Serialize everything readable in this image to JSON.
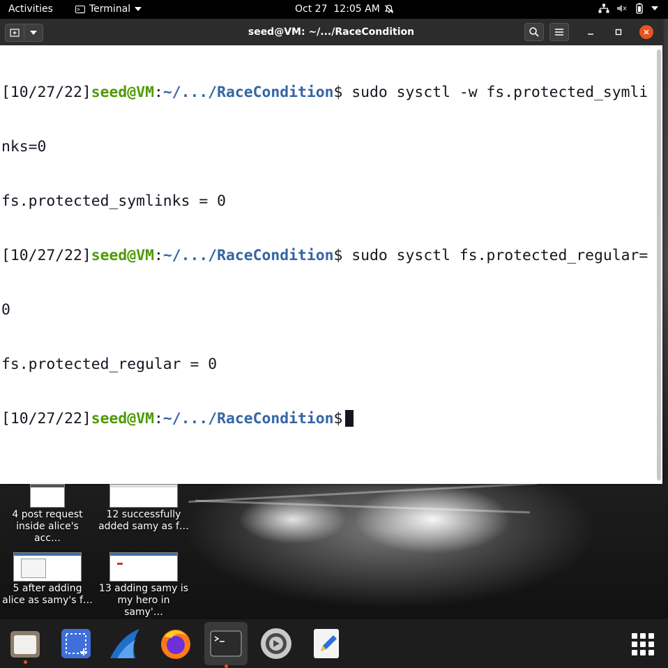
{
  "topbar": {
    "activities": "Activities",
    "app_name": "Terminal",
    "clock": "Oct 27  12:05 AM",
    "icons": [
      "network-icon",
      "volume-muted-icon",
      "battery-icon",
      "power-menu-icon",
      "notifications-off-icon"
    ]
  },
  "window": {
    "title": "seed@VM: ~/.../RaceCondition",
    "buttons": {
      "new_tab": "new-tab-icon",
      "menu_dropdown": "chevron-down-icon",
      "search": "search-icon",
      "hamburger": "hamburger-menu-icon",
      "minimize": "minimize-icon",
      "maximize": "maximize-icon",
      "close": "close-icon"
    }
  },
  "terminal": {
    "lines": [
      {
        "date": "[10/27/22]",
        "user": "seed@VM",
        "colon": ":",
        "path": "~/.../RaceCondition",
        "cmd": "$ sudo sysctl -w fs.protected_symli"
      },
      {
        "text": "nks=0"
      },
      {
        "text": "fs.protected_symlinks = 0"
      },
      {
        "date": "[10/27/22]",
        "user": "seed@VM",
        "colon": ":",
        "path": "~/.../RaceCondition",
        "cmd": "$ sudo sysctl fs.protected_regular="
      },
      {
        "text": "0"
      },
      {
        "text": "fs.protected_regular = 0"
      },
      {
        "date": "[10/27/22]",
        "user": "seed@VM",
        "colon": ":",
        "path": "~/.../RaceCondition",
        "cmd": "$"
      }
    ]
  },
  "desktop_icons": [
    {
      "label1": "4 post request",
      "label2": "inside alice's acc…"
    },
    {
      "label1": "12 successfully",
      "label2": "added samy as f…"
    },
    {
      "label1": "5 after adding",
      "label2": "alice as samy's f…"
    },
    {
      "label1": "13 adding samy is",
      "label2": "my hero in samy'…"
    }
  ],
  "dock": {
    "items": [
      "files-icon",
      "screenshot-icon",
      "wireshark-icon",
      "firefox-icon",
      "terminal-icon",
      "settings-icon",
      "text-editor-icon"
    ],
    "apps_grid": "show-applications-icon"
  },
  "colors": {
    "prompt_user": "#4e9a06",
    "prompt_path": "#3465a4",
    "accent": "#e95420"
  }
}
